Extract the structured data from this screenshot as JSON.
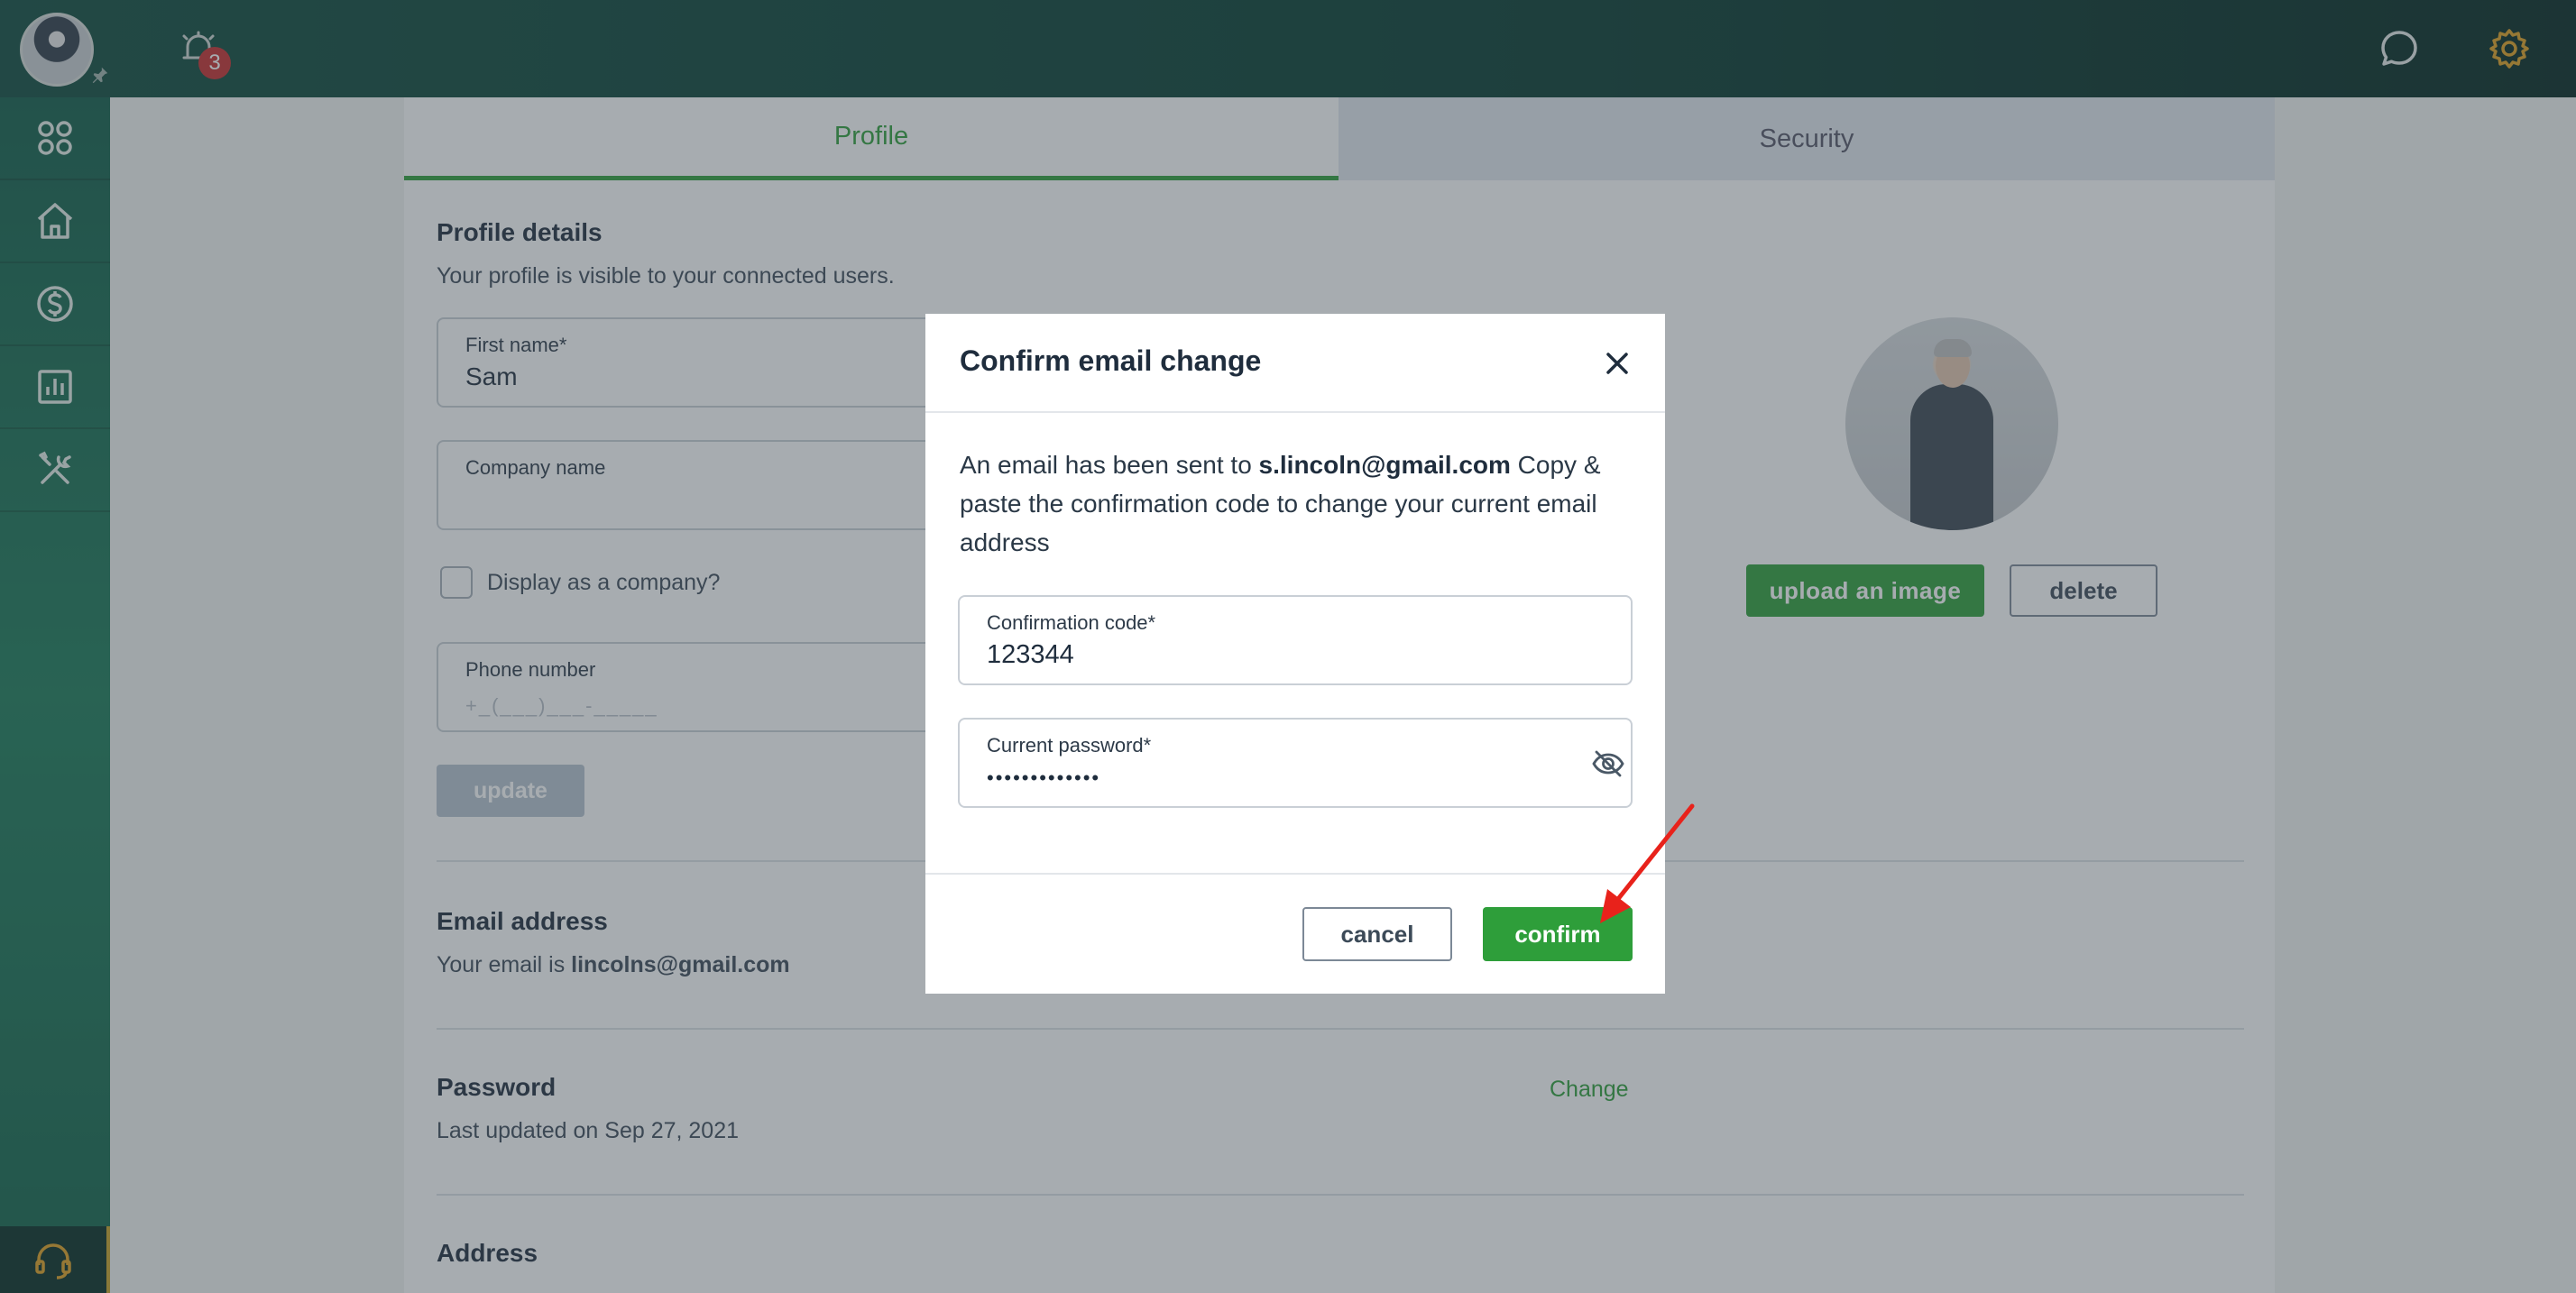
{
  "header": {
    "notification_count": "3",
    "icons": [
      "avatar",
      "pin-icon",
      "bell-icon",
      "chat-icon",
      "gear-icon"
    ]
  },
  "sidebar": {
    "items": [
      {
        "icon": "apps-grid-icon"
      },
      {
        "icon": "home-icon"
      },
      {
        "icon": "dollar-icon"
      },
      {
        "icon": "chart-icon"
      },
      {
        "icon": "tools-icon"
      }
    ],
    "support_icon": "headset-icon"
  },
  "tabs": [
    "Profile",
    "Security"
  ],
  "profile": {
    "title": "Profile details",
    "subtitle": "Your profile is visible to your connected users.",
    "first_name_label": "First name*",
    "first_name_value": "Sam",
    "company_label": "Company name",
    "company_value": "",
    "display_company_label": "Display as a company?",
    "phone_label": "Phone number",
    "phone_placeholder": "+_(___)___-_____",
    "update_button": "update",
    "upload_button": "upload an image",
    "delete_button": "delete"
  },
  "email": {
    "title": "Email address",
    "text_prefix": "Your email is ",
    "address": "lincolns@gmail.com"
  },
  "password": {
    "title": "Password",
    "change_link": "Change",
    "last_updated": "Last updated on Sep 27, 2021"
  },
  "address": {
    "title": "Address"
  },
  "modal": {
    "title": "Confirm email change",
    "msg_prefix": "An email has been sent to ",
    "msg_email": "s.lincoln@gmail.com",
    "msg_suffix": " Copy & paste the confirmation code to change your current email address",
    "code_label": "Confirmation code*",
    "code_value": "123344",
    "password_label": "Current password*",
    "password_value": "•••••••••••••",
    "cancel_button": "cancel",
    "confirm_button": "confirm"
  },
  "colors": {
    "brand_green": "#2e9e3a",
    "topbar": "#063a2f",
    "annotation_arrow": "#e8221b"
  }
}
